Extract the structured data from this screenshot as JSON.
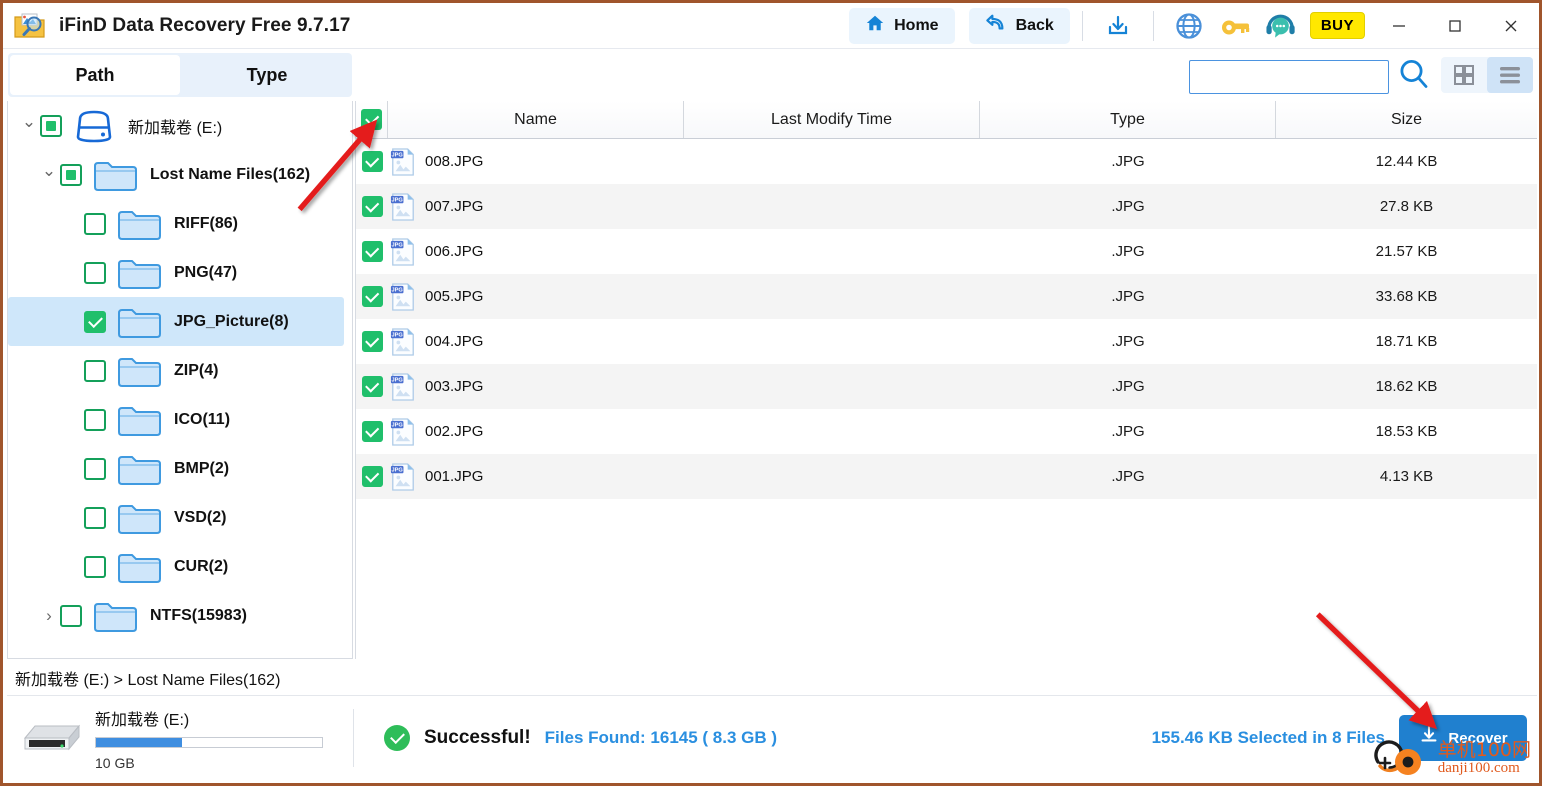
{
  "window": {
    "title": "iFinD Data Recovery Free 9.7.17",
    "app_icon": "folder-magnifier-icon",
    "minimize": "minimize-icon",
    "maximize": "maximize-icon",
    "close": "close-icon"
  },
  "toolbar": {
    "home_label": "Home",
    "home_icon": "home-icon",
    "back_label": "Back",
    "back_icon": "back-arrow-icon",
    "download_icon": "download-icon",
    "globe_icon": "globe-icon",
    "key_icon": "key-icon",
    "support_icon": "headset-support-icon",
    "buy_label": "BUY"
  },
  "tabs": [
    {
      "label": "Path",
      "active": true
    },
    {
      "label": "Type",
      "active": false
    }
  ],
  "search": {
    "value": "",
    "placeholder": "",
    "icon": "search-icon"
  },
  "view_toggle": {
    "grid_icon": "grid-view-icon",
    "list_icon": "list-view-icon",
    "active": "list"
  },
  "tree": [
    {
      "label": "新加载卷 (E:)",
      "icon": "hard-drive-icon",
      "indent": 0,
      "chevron": "down",
      "check": "partial",
      "selected": false,
      "bold": false
    },
    {
      "label": "Lost Name Files(162)",
      "icon": "folder-icon",
      "indent": 1,
      "chevron": "down",
      "check": "partial",
      "selected": false,
      "bold": true
    },
    {
      "label": "RIFF(86)",
      "icon": "folder-icon",
      "indent": 2,
      "chevron": "none",
      "check": "unchecked",
      "selected": false,
      "bold": true
    },
    {
      "label": "PNG(47)",
      "icon": "folder-icon",
      "indent": 2,
      "chevron": "none",
      "check": "unchecked",
      "selected": false,
      "bold": true
    },
    {
      "label": "JPG_Picture(8)",
      "icon": "folder-icon",
      "indent": 2,
      "chevron": "none",
      "check": "checked",
      "selected": true,
      "bold": true
    },
    {
      "label": "ZIP(4)",
      "icon": "folder-icon",
      "indent": 2,
      "chevron": "none",
      "check": "unchecked",
      "selected": false,
      "bold": true
    },
    {
      "label": "ICO(11)",
      "icon": "folder-icon",
      "indent": 2,
      "chevron": "none",
      "check": "unchecked",
      "selected": false,
      "bold": true
    },
    {
      "label": "BMP(2)",
      "icon": "folder-icon",
      "indent": 2,
      "chevron": "none",
      "check": "unchecked",
      "selected": false,
      "bold": true
    },
    {
      "label": "VSD(2)",
      "icon": "folder-icon",
      "indent": 2,
      "chevron": "none",
      "check": "unchecked",
      "selected": false,
      "bold": true
    },
    {
      "label": "CUR(2)",
      "icon": "folder-icon",
      "indent": 2,
      "chevron": "none",
      "check": "unchecked",
      "selected": false,
      "bold": true
    },
    {
      "label": "NTFS(15983)",
      "icon": "folder-icon",
      "indent": 1,
      "chevron": "right",
      "check": "unchecked",
      "selected": false,
      "bold": true
    }
  ],
  "file_table": {
    "select_all_checked": true,
    "columns": [
      "Name",
      "Last Modify Time",
      "Type",
      "Size"
    ],
    "rows": [
      {
        "name": "008.JPG",
        "modified": "",
        "type": ".JPG",
        "size": "12.44 KB",
        "checked": true,
        "icon": "jpg-file-icon"
      },
      {
        "name": "007.JPG",
        "modified": "",
        "type": ".JPG",
        "size": "27.8 KB",
        "checked": true,
        "icon": "jpg-file-icon"
      },
      {
        "name": "006.JPG",
        "modified": "",
        "type": ".JPG",
        "size": "21.57 KB",
        "checked": true,
        "icon": "jpg-file-icon"
      },
      {
        "name": "005.JPG",
        "modified": "",
        "type": ".JPG",
        "size": "33.68 KB",
        "checked": true,
        "icon": "jpg-file-icon"
      },
      {
        "name": "004.JPG",
        "modified": "",
        "type": ".JPG",
        "size": "18.71 KB",
        "checked": true,
        "icon": "jpg-file-icon"
      },
      {
        "name": "003.JPG",
        "modified": "",
        "type": ".JPG",
        "size": "18.62 KB",
        "checked": true,
        "icon": "jpg-file-icon"
      },
      {
        "name": "002.JPG",
        "modified": "",
        "type": ".JPG",
        "size": "18.53 KB",
        "checked": true,
        "icon": "jpg-file-icon"
      },
      {
        "name": "001.JPG",
        "modified": "",
        "type": ".JPG",
        "size": "4.13 KB",
        "checked": true,
        "icon": "jpg-file-icon"
      }
    ]
  },
  "breadcrumb": {
    "text": "新加载卷 (E:)  >  Lost Name Files(162)"
  },
  "status": {
    "drive_icon": "hard-disk-icon",
    "drive_name": "新加载卷 (E:)",
    "capacity": "10 GB",
    "progress_percent": 38,
    "state_icon": "success-check-icon",
    "state_text": "Successful!",
    "files_found": "Files Found:  16145 ( 8.3 GB )",
    "selection": "155.46 KB Selected in 8 Files",
    "recover_label": "Recover",
    "recover_icon": "download-icon"
  },
  "watermark": {
    "cn": "单机100网",
    "en": "danji100.com",
    "logo": "orange-circle-logo"
  },
  "colors": {
    "accent_blue": "#2080cf",
    "check_green": "#20bf6b",
    "link_blue": "#2a8fe0",
    "buy_yellow": "#ffe800",
    "selection_blue": "#cfe7fa",
    "annotation_red": "#e41f1f"
  }
}
